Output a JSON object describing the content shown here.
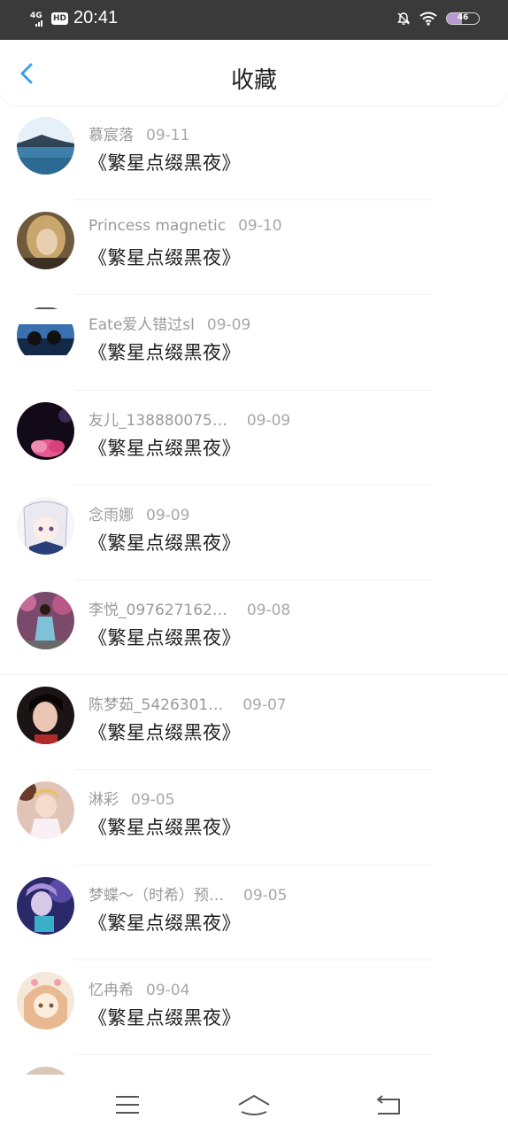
{
  "status_bar": {
    "network": "4G",
    "hd": "HD",
    "time": "20:41",
    "battery": "46",
    "battery_level": 0.46
  },
  "header": {
    "title": "收藏",
    "back_icon": "chevron-left-icon",
    "accent_color": "#3aa0e0"
  },
  "items": [
    {
      "name": "慕宸落",
      "date": "09-11",
      "work": "《繁星点缀黑夜》"
    },
    {
      "name": "Princess magnetic",
      "date": "09-10",
      "work": "《繁星点缀黑夜》"
    },
    {
      "name": "Eate爱人错过sl",
      "date": "09-09",
      "work": "《繁星点缀黑夜》"
    },
    {
      "name": "友儿_138880075…",
      "date": "09-09",
      "work": "《繁星点缀黑夜》"
    },
    {
      "name": "念雨娜",
      "date": "09-09",
      "work": "《繁星点缀黑夜》"
    },
    {
      "name": "李悦_097627162…",
      "date": "09-08",
      "work": "《繁星点缀黑夜》"
    },
    {
      "name": "陈梦茹_5426301…",
      "date": "09-07",
      "work": "《繁星点缀黑夜》"
    },
    {
      "name": "淋彩",
      "date": "09-05",
      "work": "《繁星点缀黑夜》"
    },
    {
      "name": "梦蝶～（时希）预…",
      "date": "09-05",
      "work": "《繁星点缀黑夜》"
    },
    {
      "name": "忆冉希",
      "date": "09-04",
      "work": "《繁星点缀黑夜》"
    }
  ],
  "nav": {
    "menu_icon": "menu-icon",
    "home_icon": "home-icon",
    "back_icon": "back-arrow-icon"
  }
}
